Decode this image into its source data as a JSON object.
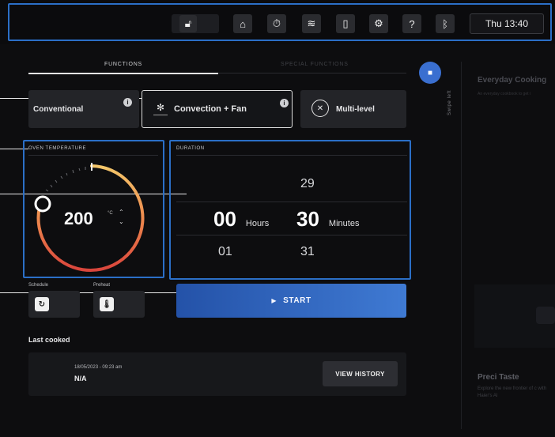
{
  "status_bar": {
    "icons": [
      "lock-icon",
      "home-icon",
      "timer-icon",
      "wifi-icon",
      "remote-icon",
      "settings-icon",
      "help-icon",
      "bluetooth-icon"
    ],
    "time": "Thu 13:40"
  },
  "tabs": [
    {
      "label": "FUNCTIONS",
      "active": true
    },
    {
      "label": "SPECIAL FUNCTIONS",
      "active": false
    }
  ],
  "functions": [
    {
      "label": "Conventional",
      "selected": false
    },
    {
      "label": "Convection + Fan",
      "selected": true
    },
    {
      "label": "Multi-level",
      "selected": false
    }
  ],
  "swipe_hint": "Swipe left",
  "oven_temperature": {
    "label": "OVEN TEMPERATURE",
    "value": "200",
    "unit": "°C"
  },
  "duration": {
    "label": "DURATION",
    "hours_above": "",
    "minutes_above": "29",
    "hours": "00",
    "hours_unit": "Hours",
    "minutes": "30",
    "minutes_unit": "Minutes",
    "hours_below": "01",
    "minutes_below": "31"
  },
  "schedule": {
    "label": "Schedule"
  },
  "preheat": {
    "label": "Preheat"
  },
  "start": {
    "label": "START"
  },
  "last_cooked": {
    "title": "Last cooked",
    "date": "18/05/2023 - 09:23 am",
    "name": "N/A",
    "button": "VIEW HISTORY"
  },
  "side_panel": {
    "title": "Everyday Cooking",
    "subtitle": "An everyday cookbook to get i",
    "title2": "Preci Taste",
    "subtitle2": "Explore the new frontier of c with Haier's AI"
  },
  "colors": {
    "accent": "#2b6fc7",
    "start_button": "#3f7ad3",
    "background": "#0d0d0f"
  }
}
